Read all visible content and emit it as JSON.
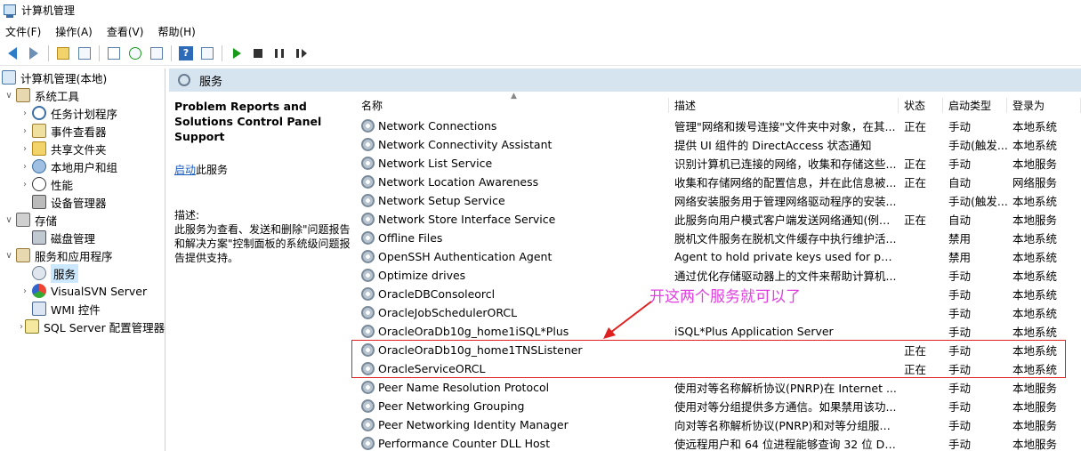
{
  "window": {
    "title": "计算机管理"
  },
  "menu": [
    "文件(F)",
    "操作(A)",
    "查看(V)",
    "帮助(H)"
  ],
  "tree": [
    {
      "label": "计算机管理(本地)",
      "icon": "computer-icon",
      "depth": 0,
      "expander": ""
    },
    {
      "label": "系统工具",
      "icon": "tools-icon",
      "depth": 0,
      "expander": "∨"
    },
    {
      "label": "任务计划程序",
      "icon": "clock-icon",
      "depth": 1,
      "expander": "›"
    },
    {
      "label": "事件查看器",
      "icon": "event-viewer-icon",
      "depth": 1,
      "expander": "›"
    },
    {
      "label": "共享文件夹",
      "icon": "shared-folder-icon",
      "depth": 1,
      "expander": "›"
    },
    {
      "label": "本地用户和组",
      "icon": "users-icon",
      "depth": 1,
      "expander": "›"
    },
    {
      "label": "性能",
      "icon": "performance-icon",
      "depth": 1,
      "expander": "›"
    },
    {
      "label": "设备管理器",
      "icon": "device-manager-icon",
      "depth": 1,
      "expander": ""
    },
    {
      "label": "存储",
      "icon": "storage-icon",
      "depth": 0,
      "expander": "∨"
    },
    {
      "label": "磁盘管理",
      "icon": "disk-icon",
      "depth": 1,
      "expander": ""
    },
    {
      "label": "服务和应用程序",
      "icon": "services-apps-icon",
      "depth": 0,
      "expander": "∨"
    },
    {
      "label": "服务",
      "icon": "services-icon",
      "depth": 1,
      "expander": "",
      "selected": true
    },
    {
      "label": "VisualSVN Server",
      "icon": "visualsvn-icon",
      "depth": 1,
      "expander": "›"
    },
    {
      "label": "WMI 控件",
      "icon": "wmi-icon",
      "depth": 1,
      "expander": ""
    },
    {
      "label": "SQL Server 配置管理器",
      "icon": "sql-server-icon",
      "depth": 1,
      "expander": "›"
    }
  ],
  "main": {
    "header": "服务",
    "selected_service": {
      "title": "Problem Reports and Solutions Control Panel Support",
      "start_link": "启动",
      "start_suffix": "此服务",
      "desc_label": "描述:",
      "desc_text": "此服务为查看、发送和删除\"问题报告和解决方案\"控制面板的系统级问题报告提供支持。"
    },
    "columns": [
      "名称",
      "描述",
      "状态",
      "启动类型",
      "登录为"
    ],
    "rows": [
      {
        "name": "Network Connections",
        "desc": "管理\"网络和拨号连接\"文件夹中对象，在其...",
        "state": "正在",
        "start": "手动",
        "logon": "本地系统"
      },
      {
        "name": "Network Connectivity Assistant",
        "desc": "提供 UI 组件的 DirectAccess 状态通知",
        "state": "",
        "start": "手动(触发...",
        "logon": "本地系统"
      },
      {
        "name": "Network List Service",
        "desc": "识别计算机已连接的网络，收集和存储这些...",
        "state": "正在",
        "start": "手动",
        "logon": "本地服务"
      },
      {
        "name": "Network Location Awareness",
        "desc": "收集和存储网络的配置信息，并在此信息被...",
        "state": "正在",
        "start": "自动",
        "logon": "网络服务"
      },
      {
        "name": "Network Setup Service",
        "desc": "网络安装服务用于管理网络驱动程序的安装...",
        "state": "",
        "start": "手动(触发...",
        "logon": "本地系统"
      },
      {
        "name": "Network Store Interface Service",
        "desc": "此服务向用户模式客户端发送网络通知(例如...",
        "state": "正在",
        "start": "自动",
        "logon": "本地服务"
      },
      {
        "name": "Offline Files",
        "desc": "脱机文件服务在脱机文件缓存中执行维护活...",
        "state": "",
        "start": "禁用",
        "logon": "本地系统"
      },
      {
        "name": "OpenSSH Authentication Agent",
        "desc": "Agent to hold private keys used for pub...",
        "state": "",
        "start": "禁用",
        "logon": "本地系统"
      },
      {
        "name": "Optimize drives",
        "desc": "通过优化存储驱动器上的文件来帮助计算机...",
        "state": "",
        "start": "手动",
        "logon": "本地系统"
      },
      {
        "name": "OracleDBConsoleorcl",
        "desc": "",
        "state": "",
        "start": "手动",
        "logon": "本地系统"
      },
      {
        "name": "OracleJobSchedulerORCL",
        "desc": "",
        "state": "",
        "start": "手动",
        "logon": "本地系统"
      },
      {
        "name": "OracleOraDb10g_home1iSQL*Plus",
        "desc": "iSQL*Plus Application Server",
        "state": "",
        "start": "手动",
        "logon": "本地系统"
      },
      {
        "name": "OracleOraDb10g_home1TNSListener",
        "desc": "",
        "state": "正在",
        "start": "手动",
        "logon": "本地系统"
      },
      {
        "name": "OracleServiceORCL",
        "desc": "",
        "state": "正在",
        "start": "手动",
        "logon": "本地系统"
      },
      {
        "name": "Peer Name Resolution Protocol",
        "desc": "使用对等名称解析协议(PNRP)在 Internet ...",
        "state": "",
        "start": "手动",
        "logon": "本地服务"
      },
      {
        "name": "Peer Networking Grouping",
        "desc": "使用对等分组提供多方通信。如果禁用该功...",
        "state": "",
        "start": "手动",
        "logon": "本地服务"
      },
      {
        "name": "Peer Networking Identity Manager",
        "desc": "向对等名称解析协议(PNRP)和对等分组服务...",
        "state": "",
        "start": "手动",
        "logon": "本地服务"
      },
      {
        "name": "Performance Counter DLL Host",
        "desc": "使远程用户和 64 位进程能够查询 32 位 DL...",
        "state": "",
        "start": "手动",
        "logon": "本地服务"
      }
    ]
  },
  "annotation": {
    "text": "开这两个服务就可以了",
    "color": "#e040e0"
  },
  "colors": {
    "highlight_border": "#e02020",
    "header_bg": "#d6e4f0",
    "selection_bg": "#cce8ff",
    "link": "#1a5bbf"
  }
}
